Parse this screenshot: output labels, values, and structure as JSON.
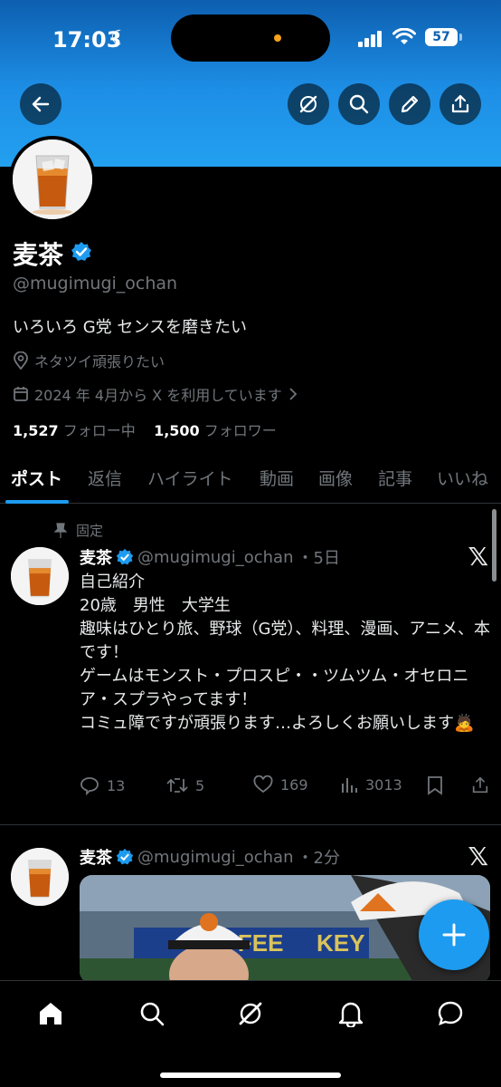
{
  "status_bar": {
    "time": "17:03",
    "battery": "57"
  },
  "profile": {
    "display_name": "麦茶",
    "handle": "@mugimugi_ochan",
    "bio": "いろいろ G党 センスを磨きたい",
    "location": "ネタツイ頑張りたい",
    "joined": "2024 年 4月から X を利用しています",
    "following_count": "1,527",
    "following_label": "フォロー中",
    "followers_count": "1,500",
    "followers_label": "フォロワー"
  },
  "tabs": [
    {
      "label": "ポスト"
    },
    {
      "label": "返信"
    },
    {
      "label": "ハイライト"
    },
    {
      "label": "動画"
    },
    {
      "label": "画像"
    },
    {
      "label": "記事"
    },
    {
      "label": "いいね"
    }
  ],
  "pinned_label": "固定",
  "tweets": [
    {
      "name": "麦茶",
      "handle": "@mugimugi_ochan",
      "time": "・5日",
      "body": [
        "自己紹介",
        "20歳　男性　大学生",
        "趣味はひとり旅、野球（G党）、料理、漫画、アニメ、本です！",
        "ゲームはモンスト・プロスピ・・ツムツム・オセロニア・スプラやってます！",
        "コミュ障ですが頑張ります…よろしくお願いします🙇"
      ],
      "replies": "13",
      "reposts": "5",
      "likes": "169",
      "views": "3013"
    },
    {
      "name": "麦茶",
      "handle": "@mugimugi_ochan",
      "time": "・2分"
    }
  ],
  "media_text": {
    "sign1": "COFFEE",
    "sign2": "KEY"
  },
  "icons": {
    "back": "arrow-left-icon",
    "grok": "grok-icon",
    "search": "search-icon",
    "edit": "pencil-icon",
    "share": "share-icon"
  },
  "colors": {
    "accent": "#1d9bf0",
    "banner": "#1d8fe6",
    "muted": "#71767b"
  }
}
